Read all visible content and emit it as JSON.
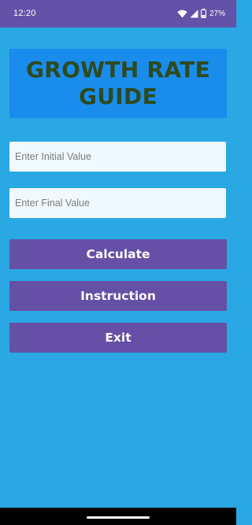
{
  "status_bar": {
    "time": "12:20",
    "battery_percent": "27%",
    "icons": [
      "wifi-icon",
      "signal-icon",
      "battery-icon"
    ],
    "background": "#6352A8"
  },
  "header": {
    "title_line1": "GROWTH RATE",
    "title_line2": "GUIDE",
    "title_color": "#2E4A1E",
    "background": "#1A8CEC"
  },
  "form": {
    "initial_placeholder": "Enter Initial Value",
    "final_placeholder": "Enter Final Value",
    "initial_value": "",
    "final_value": ""
  },
  "buttons": {
    "calculate": "Calculate",
    "instruction": "Instruction",
    "exit": "Exit",
    "background": "#6550A6"
  },
  "theme": {
    "page_background": "#29A8E3"
  }
}
